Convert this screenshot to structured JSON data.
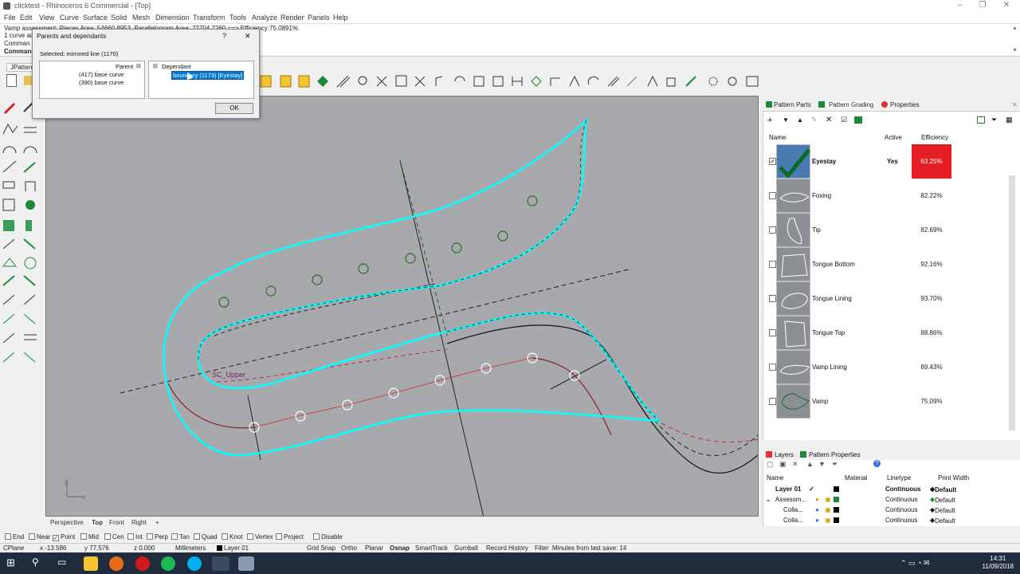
{
  "window": {
    "title": "clicktest - Rhinoceros 6 Commercial - [Top]",
    "controls": [
      "–",
      "❐",
      "✕"
    ]
  },
  "menu": [
    "File",
    "Edit",
    "View",
    "Curve",
    "Surface",
    "Solid",
    "Mesh",
    "Dimension",
    "Transform",
    "Tools",
    "Analyze",
    "Render",
    "Panels",
    "Help"
  ],
  "command_history": [
    "Vamp assessment: Pieces Area: 54660.8953, Parallelogram Area: 72704.7260 ==> Efficiency:75.0891%",
    "1 curve ad",
    "Comman",
    "Command"
  ],
  "toolbar_tab": "JPattern",
  "dialog": {
    "title": "Parents and dependants",
    "help": "?",
    "close": "✕",
    "selected": "Selected: mirrored line (1170)",
    "parent_header": "Parent",
    "parents": [
      "(417) base curve",
      "(390) base curve"
    ],
    "dependant_header": "Dependant",
    "dependants": [
      "boundary (1173) [Eyestay]"
    ],
    "ok_label": "OK"
  },
  "viewport": {
    "curve_label": "SC_Upper",
    "axis_y": "y",
    "axis_x": "x",
    "tabs": [
      "Perspective",
      "Top",
      "Front",
      "Right",
      "+"
    ]
  },
  "osnaps": [
    {
      "label": "End",
      "checked": false
    },
    {
      "label": "Near",
      "checked": false
    },
    {
      "label": "Point",
      "checked": true
    },
    {
      "label": "Mid",
      "checked": false
    },
    {
      "label": "Cen",
      "checked": false
    },
    {
      "label": "Int",
      "checked": false
    },
    {
      "label": "Perp",
      "checked": false
    },
    {
      "label": "Tan",
      "checked": false
    },
    {
      "label": "Quad",
      "checked": false
    },
    {
      "label": "Knot",
      "checked": false
    },
    {
      "label": "Vertex",
      "checked": false
    },
    {
      "label": "Project",
      "checked": false
    },
    {
      "label": "Disable",
      "checked": false
    }
  ],
  "status": {
    "cplane": "CPlane",
    "x": "x -13.586",
    "y": "y 77.576",
    "z": "z 0.000",
    "units": "Millimeters",
    "layer": "Layer 01",
    "toggles": [
      "Grid Snap",
      "Ortho",
      "Planar",
      "Osnap",
      "SmartTrack",
      "Gumball",
      "Record History",
      "Filter"
    ],
    "save_info": "Minutes from last save: 14"
  },
  "clock": {
    "time": "14:31",
    "date": "11/09/2018"
  },
  "panel_tabs": [
    "Pattern Parts",
    "Pattern Grading",
    "Properties"
  ],
  "parts_table": {
    "headers": {
      "name": "Name",
      "active": "Active",
      "efficiency": "Efficiency"
    },
    "rows": [
      {
        "name": "Eyestay",
        "active": "Yes",
        "efficiency": "63.25%",
        "checked": true
      },
      {
        "name": "Foxing",
        "active": "",
        "efficiency": "82.22%",
        "checked": false
      },
      {
        "name": "Tip",
        "active": "",
        "efficiency": "82.69%",
        "checked": false
      },
      {
        "name": "Tongue Bottom",
        "active": "",
        "efficiency": "92.16%",
        "checked": false
      },
      {
        "name": "Tongue Lining",
        "active": "",
        "efficiency": "93.70%",
        "checked": false
      },
      {
        "name": "Tongue Top",
        "active": "",
        "efficiency": "88.86%",
        "checked": false
      },
      {
        "name": "Vamp Lining",
        "active": "",
        "efficiency": "89.43%",
        "checked": false
      },
      {
        "name": "Vamp",
        "active": "",
        "efficiency": "75.09%",
        "checked": false
      }
    ]
  },
  "layers_tabs": [
    "Layers",
    "Pattern Properties"
  ],
  "layers_table": {
    "headers": {
      "name": "Name",
      "material": "Material",
      "linetype": "Linetype",
      "print_width": "Print Width"
    },
    "rows": [
      {
        "name": "Layer 01",
        "current": "✓",
        "linetype": "Continuous",
        "print_width": "Default",
        "bold": true
      },
      {
        "name": "Assessm...",
        "current": "",
        "linetype": "Continuous",
        "print_width": "Default",
        "bold": false
      },
      {
        "name": "Colla...",
        "current": "",
        "linetype": "Continuous",
        "print_width": "Default",
        "bold": false
      },
      {
        "name": "Colla...",
        "current": "",
        "linetype": "Continuous",
        "print_width": "Default",
        "bold": false
      }
    ]
  },
  "colors": {
    "viewport": "#a7a9ac",
    "boundary": "#00ffff",
    "highlight": "#e31e24",
    "selection": "#0078d7",
    "taskbar": "#202b3d"
  }
}
